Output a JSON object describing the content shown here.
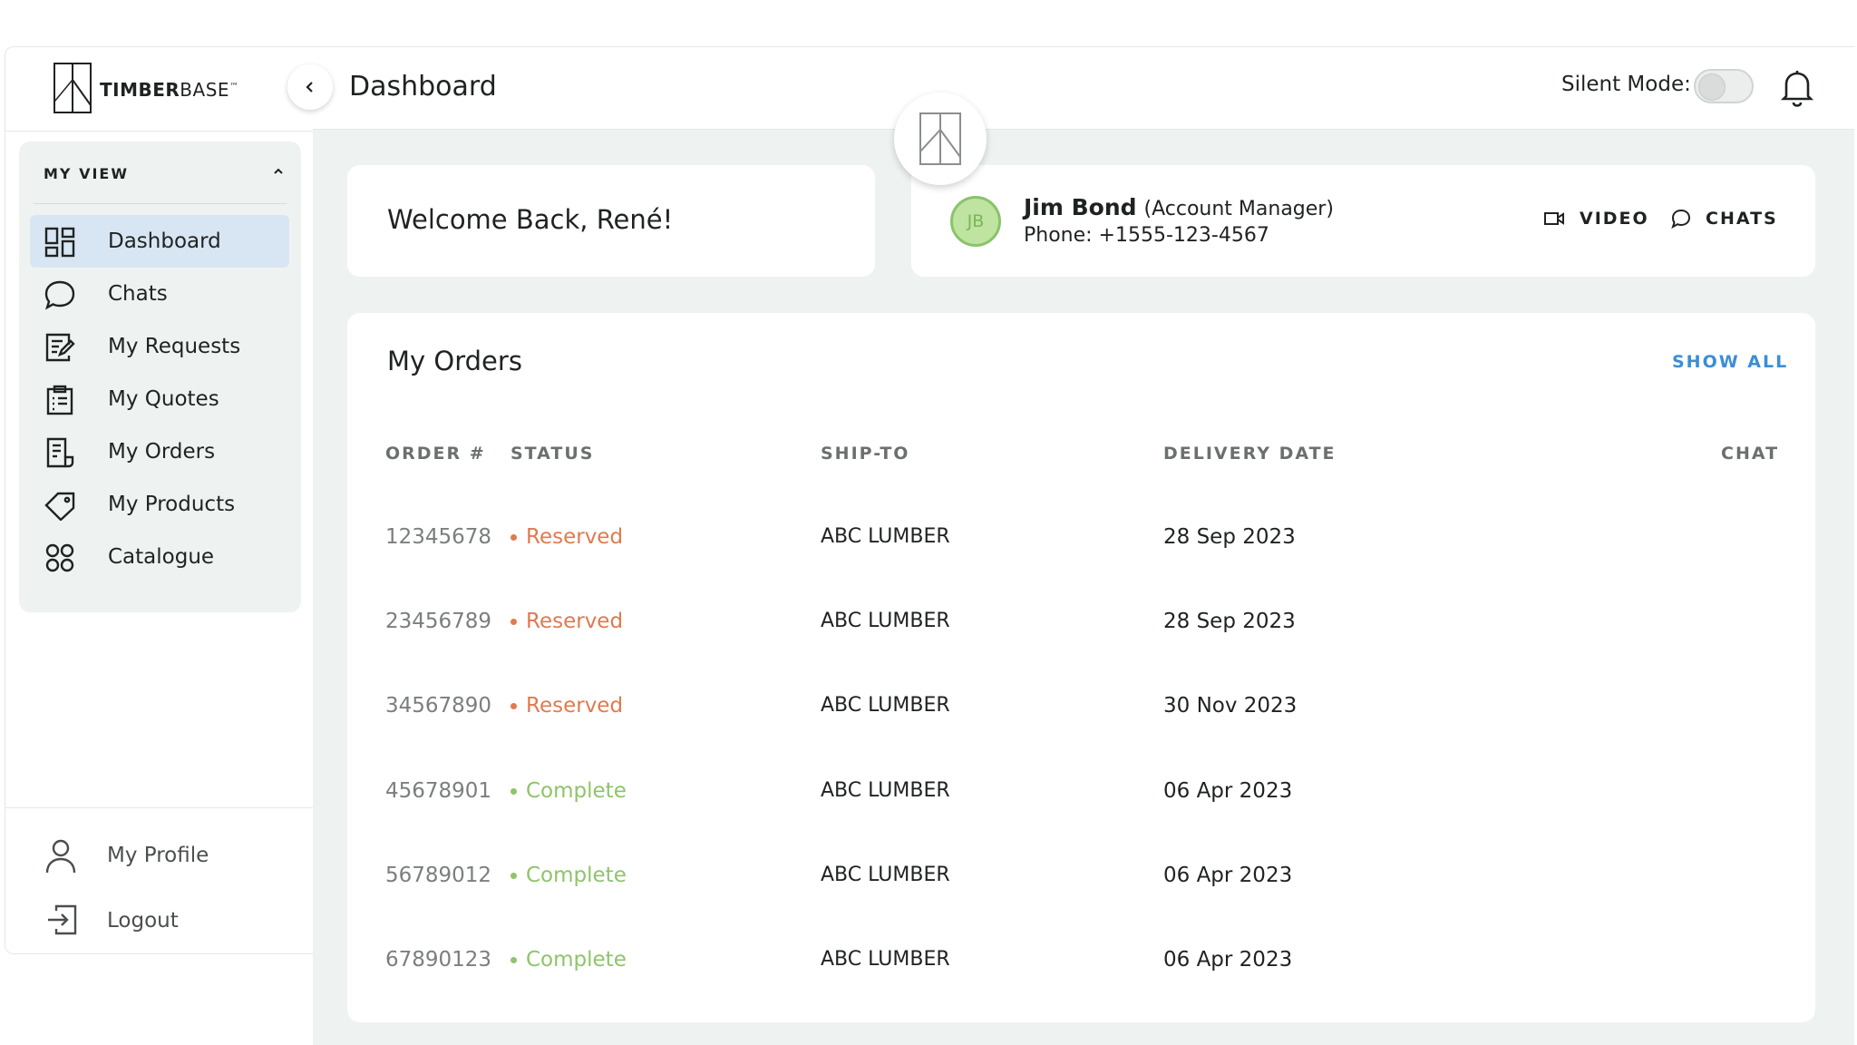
{
  "app": {
    "logo_bold": "TIMBER",
    "logo_light": "BASE",
    "logo_tm": "™"
  },
  "header": {
    "title": "Dashboard",
    "silent_mode_label": "Silent Mode:",
    "silent_mode_on": false
  },
  "sidebar": {
    "section_title": "MY VIEW",
    "items": [
      {
        "label": "Dashboard",
        "icon": "dashboard-icon",
        "active": true
      },
      {
        "label": "Chats",
        "icon": "chat-bubble-icon",
        "active": false
      },
      {
        "label": "My Requests",
        "icon": "request-edit-icon",
        "active": false
      },
      {
        "label": "My Quotes",
        "icon": "clipboard-icon",
        "active": false
      },
      {
        "label": "My Orders",
        "icon": "receipt-icon",
        "active": false
      },
      {
        "label": "My Products",
        "icon": "tag-icon",
        "active": false
      },
      {
        "label": "Catalogue",
        "icon": "grid-circles-icon",
        "active": false
      }
    ],
    "bottom": [
      {
        "label": "My Profile",
        "icon": "user-icon"
      },
      {
        "label": "Logout",
        "icon": "logout-icon"
      }
    ]
  },
  "welcome": {
    "text": "Welcome Back, René!"
  },
  "contact": {
    "initials": "JB",
    "name": "Jim Bond",
    "role": "(Account Manager)",
    "phone": "Phone: +1555-123-4567",
    "video_label": "VIDEO",
    "chats_label": "CHATS"
  },
  "orders": {
    "title": "My Orders",
    "show_all": "SHOW ALL",
    "columns": {
      "order": "ORDER #",
      "status": "STATUS",
      "ship_to": "SHIP-TO",
      "delivery_date": "DELIVERY DATE",
      "chat": "CHAT"
    },
    "rows": [
      {
        "order": "12345678",
        "status": "Reserved",
        "ship_to": "ABC LUMBER",
        "date": "28 Sep 2023"
      },
      {
        "order": "23456789",
        "status": "Reserved",
        "ship_to": "ABC LUMBER",
        "date": "28 Sep 2023"
      },
      {
        "order": "34567890",
        "status": "Reserved",
        "ship_to": "ABC LUMBER",
        "date": "30 Nov 2023"
      },
      {
        "order": "45678901",
        "status": "Complete",
        "ship_to": "ABC LUMBER",
        "date": "06 Apr 2023"
      },
      {
        "order": "56789012",
        "status": "Complete",
        "ship_to": "ABC LUMBER",
        "date": "06 Apr 2023"
      },
      {
        "order": "67890123",
        "status": "Complete",
        "ship_to": "ABC LUMBER",
        "date": "06 Apr 2023"
      }
    ]
  },
  "colors": {
    "reserved": "#e07a50",
    "complete": "#8fc46a",
    "accent_blue": "#3b8ed6",
    "active_nav": "#d8e6f4"
  }
}
